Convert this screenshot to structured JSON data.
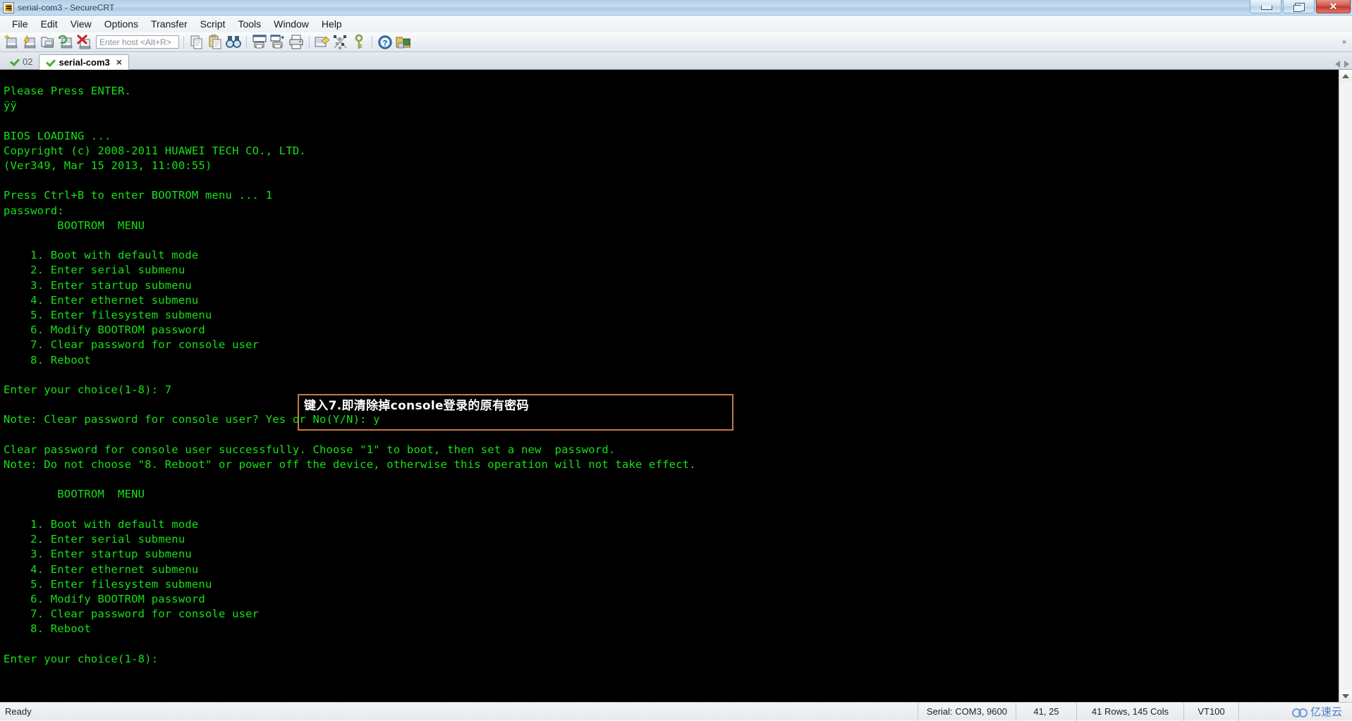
{
  "window": {
    "title": "serial-com3 - SecureCRT",
    "icon": "securecrt-app-icon",
    "buttons": {
      "minimize": "minimize",
      "maximize": "maximize",
      "close": "✕"
    }
  },
  "menubar": {
    "items": [
      {
        "label": "File"
      },
      {
        "label": "Edit"
      },
      {
        "label": "View"
      },
      {
        "label": "Options"
      },
      {
        "label": "Transfer"
      },
      {
        "label": "Script"
      },
      {
        "label": "Tools"
      },
      {
        "label": "Window"
      },
      {
        "label": "Help"
      }
    ]
  },
  "toolbar": {
    "host_placeholder": "Enter host <Alt+R>",
    "host_value": "",
    "overflow_label": "»",
    "icons": [
      {
        "name": "new-session-icon"
      },
      {
        "name": "quick-connect-icon"
      },
      {
        "name": "open-session-icon"
      },
      {
        "name": "reconnect-icon"
      },
      {
        "name": "disconnect-icon"
      },
      {
        "name": "copy-icon"
      },
      {
        "name": "paste-icon"
      },
      {
        "name": "find-icon"
      },
      {
        "name": "print-screen-icon"
      },
      {
        "name": "log-session-icon"
      },
      {
        "name": "print-icon"
      },
      {
        "name": "session-options-icon"
      },
      {
        "name": "scramble-keys-icon"
      },
      {
        "name": "key-icon"
      },
      {
        "name": "help-icon"
      },
      {
        "name": "secure-folder-icon"
      }
    ]
  },
  "tabs": {
    "items": [
      {
        "label": "02",
        "active": false,
        "status_icon": "green-check-icon"
      },
      {
        "label": "serial-com3",
        "active": true,
        "status_icon": "green-check-icon",
        "close_glyph": "×"
      }
    ],
    "nav_left": "scroll-tabs-left",
    "nav_right": "scroll-tabs-right"
  },
  "terminal": {
    "foreground_color": "#17e017",
    "background_color": "#000000",
    "lines": [
      "Please Press ENTER.",
      "ÿÿ",
      "",
      "BIOS LOADING ...",
      "Copyright (c) 2008-2011 HUAWEI TECH CO., LTD.",
      "(Ver349, Mar 15 2013, 11:00:55)",
      "",
      "Press Ctrl+B to enter BOOTROM menu ... 1",
      "password:",
      "        BOOTROM  MENU",
      "",
      "    1. Boot with default mode",
      "    2. Enter serial submenu",
      "    3. Enter startup submenu",
      "    4. Enter ethernet submenu",
      "    5. Enter filesystem submenu",
      "    6. Modify BOOTROM password",
      "    7. Clear password for console user",
      "    8. Reboot",
      "",
      "Enter your choice(1-8): 7",
      "",
      "Note: Clear password for console user? Yes or No(Y/N): y",
      "",
      "Clear password for console user successfully. Choose \"1\" to boot, then set a new  password.",
      "Note: Do not choose \"8. Reboot\" or power off the device, otherwise this operation will not take effect.",
      "",
      "        BOOTROM  MENU",
      "",
      "    1. Boot with default mode",
      "    2. Enter serial submenu",
      "    3. Enter startup submenu",
      "    4. Enter ethernet submenu",
      "    5. Enter filesystem submenu",
      "    6. Modify BOOTROM password",
      "    7. Clear password for console user",
      "    8. Reboot",
      "",
      "Enter your choice(1-8):"
    ]
  },
  "annotation": {
    "text": "键入7.即清除掉console登录的原有密码",
    "border_color": "#c8784a",
    "text_color": "#ffffff"
  },
  "statusbar": {
    "ready": "Ready",
    "serial": "Serial: COM3, 9600",
    "cursor_position": "41,  25",
    "screen_size": "41 Rows, 145 Cols",
    "emulation": "VT100",
    "extra": "",
    "watermark": "亿速云"
  }
}
